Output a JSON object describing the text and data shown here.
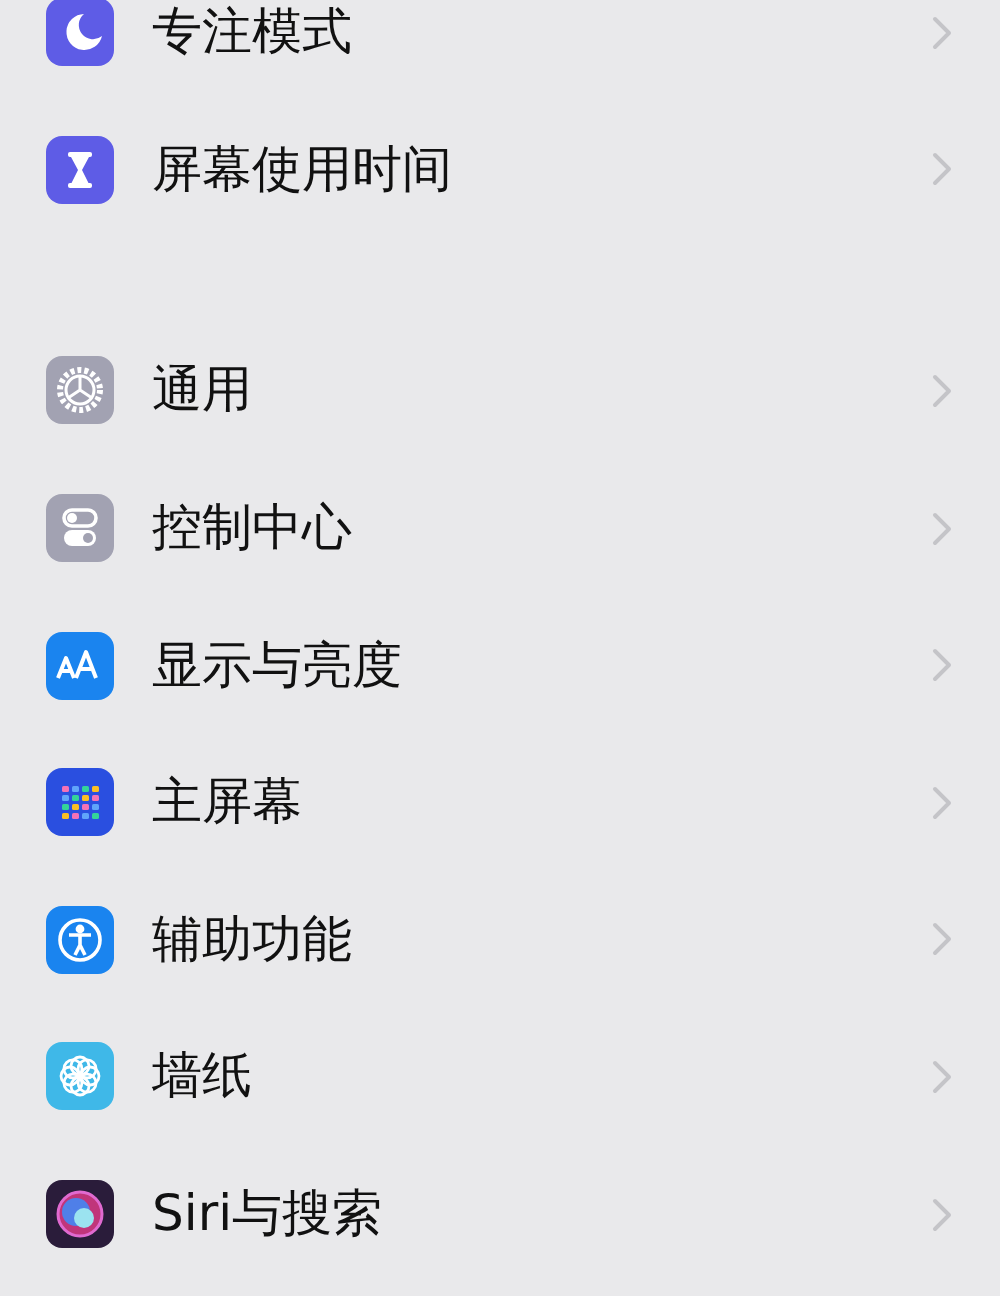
{
  "groups": [
    {
      "items": [
        {
          "kind": "moon",
          "label": "专注模式",
          "color": "#5e5ce6"
        },
        {
          "kind": "hourglass",
          "label": "屏幕使用时间",
          "color": "#5e5ce6"
        }
      ]
    },
    {
      "items": [
        {
          "kind": "gear",
          "label": "通用",
          "color": "#a2a2b2"
        },
        {
          "kind": "toggles",
          "label": "控制中心",
          "color": "#a2a2b2"
        },
        {
          "kind": "text-size",
          "label": "显示与亮度",
          "color": "#1a84ef"
        },
        {
          "kind": "app-grid",
          "label": "主屏幕",
          "color": "#2a4fe0"
        },
        {
          "kind": "accessibility",
          "label": "辅助功能",
          "color": "#1a84ef"
        },
        {
          "kind": "flower",
          "label": "墙纸",
          "color": "#3fb8e8"
        },
        {
          "kind": "orb",
          "label": "Siri与搜索",
          "color": "#2a1c3a"
        }
      ]
    }
  ]
}
